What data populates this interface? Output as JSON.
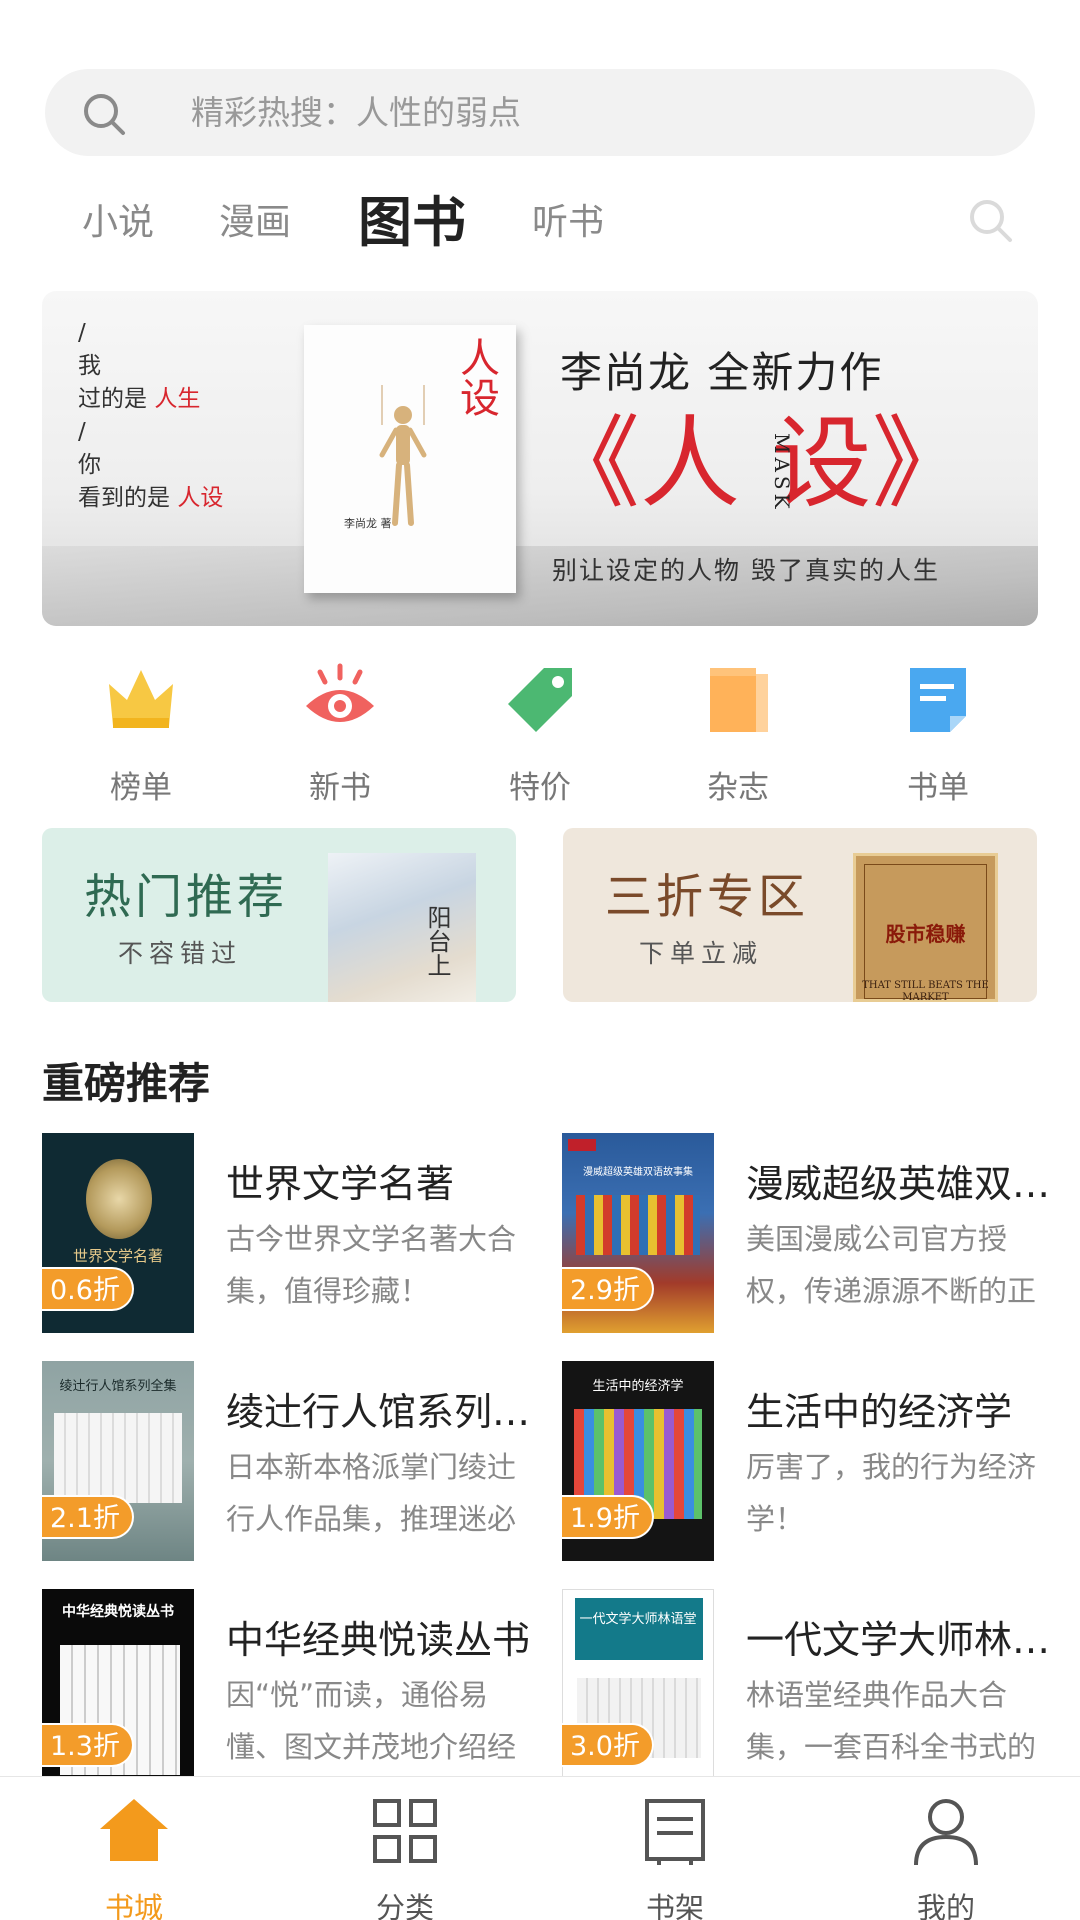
{
  "search": {
    "placeholder": "精彩热搜：人性的弱点"
  },
  "tabs": [
    {
      "label": "小说"
    },
    {
      "label": "漫画"
    },
    {
      "label": "图书"
    },
    {
      "label": "听书"
    }
  ],
  "banner": {
    "left_line1": "我",
    "left_line2_pre": "过的是",
    "left_line2_red": "人生",
    "left_line3": "你",
    "left_line4_pre": "看到的是",
    "left_line4_red": "人设",
    "book_title": "人设",
    "book_author": "李尚龙 著",
    "headline": "李尚龙  全新力作",
    "big_title": "《人 设》",
    "mask": "MASK",
    "tagline": "别让设定的人物  毁了真实的人生"
  },
  "quick": [
    {
      "label": "榜单",
      "icon": "crown-icon",
      "color": "#f7c843"
    },
    {
      "label": "新书",
      "icon": "eye-icon",
      "color": "#f0625f"
    },
    {
      "label": "特价",
      "icon": "tag-icon",
      "color": "#4cb872"
    },
    {
      "label": "杂志",
      "icon": "magazine-icon",
      "color": "#ffb259"
    },
    {
      "label": "书单",
      "icon": "booklist-icon",
      "color": "#4aa8f0"
    }
  ],
  "promos": {
    "hot": {
      "title": "热门推荐",
      "subtitle": "不容错过",
      "cover_title": "阳台上"
    },
    "sale": {
      "title": "三折专区",
      "subtitle": "下单立减",
      "cover_title": "股市稳赚",
      "cover_sub": "THAT STILL BEATS THE MARKET"
    }
  },
  "section": {
    "title": "重磅推荐"
  },
  "books": [
    {
      "title": "世界文学名著",
      "desc": "古今世界文学名著大合集，值得珍藏！",
      "discount": "0.6折",
      "cover_text": "世界文学名著"
    },
    {
      "title": "漫威超级英雄双语故事集",
      "desc": "美国漫威公司官方授权，传递源源不断的正能量",
      "discount": "2.9折",
      "cover_text": "漫威超级英雄双语故事集"
    },
    {
      "title": "绫辻行人馆系列全集",
      "desc": "日本新本格派掌门绫辻行人作品集，推理迷必读",
      "discount": "2.1折",
      "cover_text": "绫辻行人馆系列全集"
    },
    {
      "title": "生活中的经济学",
      "desc": "厉害了，我的行为经济学！",
      "discount": "1.9折",
      "cover_text": "生活中的经济学"
    },
    {
      "title": "中华经典悦读丛书",
      "desc": "因“悦”而读，通俗易懂、图文并茂地介绍经典",
      "discount": "1.3折",
      "cover_text": "中华经典悦读丛书"
    },
    {
      "title": "一代文学大师林语堂",
      "desc": "林语堂经典作品大合集，一套百科全书式的作品",
      "discount": "3.0折",
      "cover_text": "一代文学大师林语堂"
    }
  ],
  "nav": [
    {
      "label": "书城",
      "icon": "home-icon"
    },
    {
      "label": "分类",
      "icon": "grid-icon"
    },
    {
      "label": "书架",
      "icon": "bookshelf-icon"
    },
    {
      "label": "我的",
      "icon": "user-icon"
    }
  ],
  "colors": {
    "accent": "#f39a1c",
    "discount_badge": "#f39c2a",
    "banner_red": "#d8262e"
  }
}
